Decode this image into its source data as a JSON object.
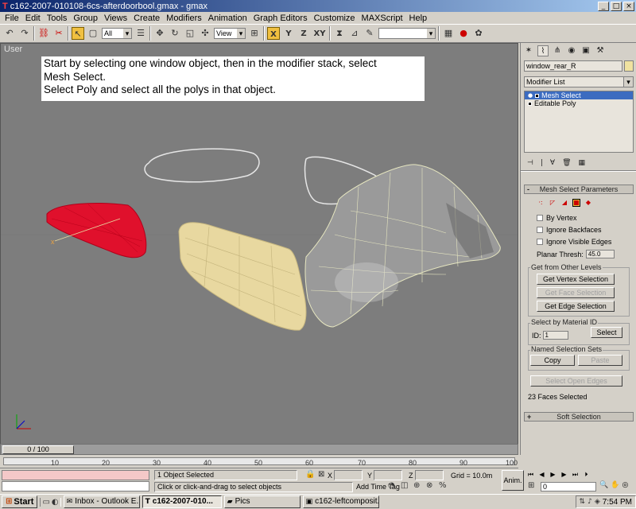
{
  "window": {
    "title": "c162-2007-010108-6cs-afterdoorbool.gmax - gmax",
    "minimize": "_",
    "maximize": "□",
    "close": "×"
  },
  "menu": [
    "File",
    "Edit",
    "Tools",
    "Group",
    "Views",
    "Create",
    "Modifiers",
    "Animation",
    "Graph Editors",
    "Customize",
    "MAXScript",
    "Help"
  ],
  "toolbar": {
    "selection_filter": "All",
    "reference_coord": "View",
    "axis_labels": [
      "X",
      "Y",
      "Z",
      "XY"
    ]
  },
  "viewport": {
    "label": "User",
    "instructions": [
      "Start by selecting one window object, then in the modifier stack, select",
      "Mesh Select.",
      "Select Poly and select all the polys in that object."
    ],
    "axis": {
      "x": "x",
      "y": "y",
      "z": "z"
    }
  },
  "command_panel": {
    "object_name": "window_rear_R",
    "object_color": "#f0e2a0",
    "modifier_list": "Modifier List",
    "stack": [
      {
        "label": "Mesh Select",
        "selected": true
      },
      {
        "label": "Editable Poly",
        "selected": false
      }
    ],
    "mesh_select": {
      "title": "Mesh Select Parameters",
      "checkboxes": [
        "By Vertex",
        "Ignore Backfaces",
        "Ignore Visible Edges"
      ],
      "planar_label": "Planar Thresh:",
      "planar_value": "45.0",
      "get_other_levels": "Get from Other Levels",
      "get_vertex": "Get Vertex Selection",
      "get_face": "Get Face Selection",
      "get_edge": "Get Edge Selection",
      "by_material": "Select by Material ID",
      "id_label": "ID:",
      "id_value": "1",
      "select_btn": "Select",
      "named_sets": "Named Selection Sets",
      "copy": "Copy",
      "paste": "Paste",
      "select_open_edges": "Select Open Edges",
      "status": "23 Faces Selected"
    },
    "soft_selection": "Soft Selection"
  },
  "time": {
    "slider": "0 / 100",
    "ticks": [
      "10",
      "20",
      "30",
      "40",
      "50",
      "60",
      "70",
      "80",
      "90",
      "100"
    ]
  },
  "status": {
    "selected": "1 Object Selected",
    "prompt": "Click or click-and-drag to select objects",
    "x_label": "X",
    "y_label": "Y",
    "z_label": "Z",
    "grid": "Grid = 10.0m",
    "add_time_tag": "Add Time Tag",
    "anim": "Anim.",
    "frame": "0"
  },
  "taskbar": {
    "start": "Start",
    "tasks": [
      {
        "label": "Inbox - Outlook E...",
        "active": false
      },
      {
        "label": "c162-2007-010...",
        "active": true
      },
      {
        "label": "Pics",
        "active": false
      },
      {
        "label": "c162-leftcomposit...",
        "active": false
      }
    ],
    "clock": "7:54 PM"
  },
  "colors": {
    "viewport_bg": "#7d7d7d",
    "selected_object": "#e0102c",
    "tan_object": "#e8d8a0",
    "title_gradient_start": "#0a246a"
  }
}
